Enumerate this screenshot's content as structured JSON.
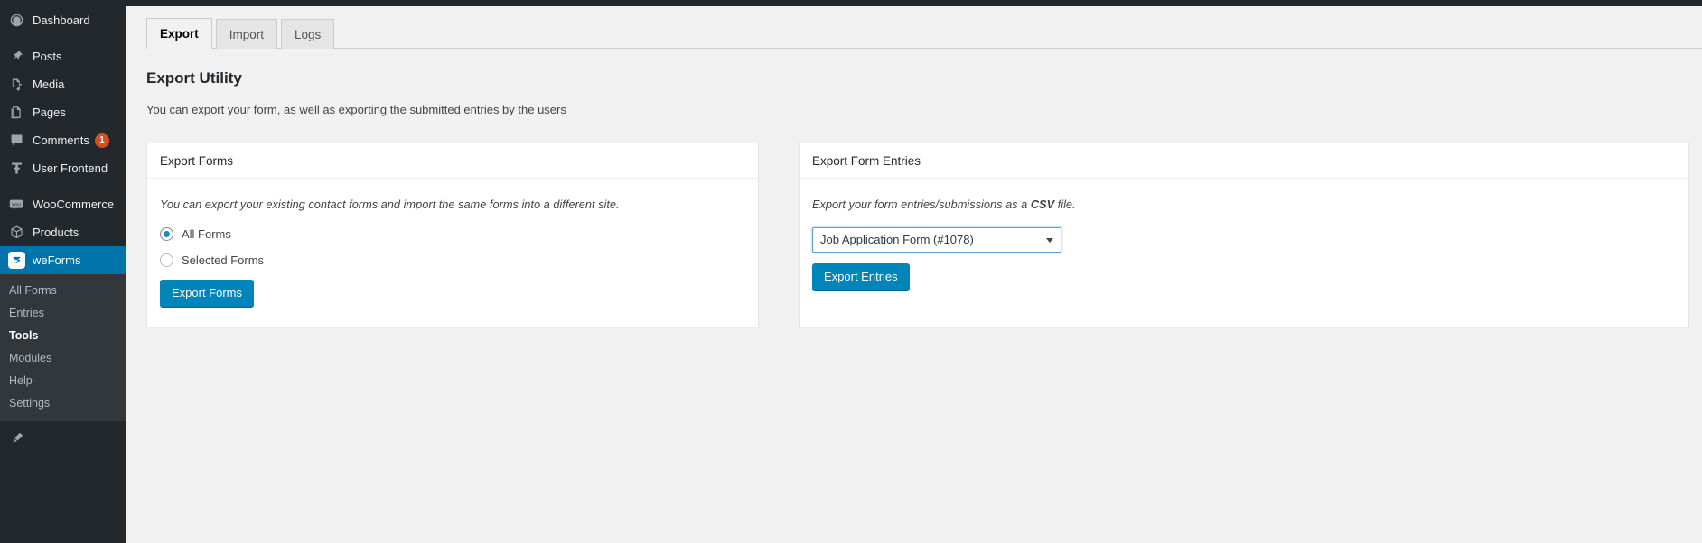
{
  "admin_menu": {
    "items": [
      {
        "label": "Dashboard",
        "icon": "dashboard-icon",
        "active": false
      },
      {
        "label": "Posts",
        "icon": "pin-icon",
        "active": false
      },
      {
        "label": "Media",
        "icon": "media-icon",
        "active": false
      },
      {
        "label": "Pages",
        "icon": "pages-icon",
        "active": false
      },
      {
        "label": "Comments",
        "icon": "comment-icon",
        "active": false,
        "badge": "1"
      },
      {
        "label": "User Frontend",
        "icon": "user-frontend-icon",
        "active": false
      },
      {
        "label": "WooCommerce",
        "icon": "woocommerce-icon",
        "active": false
      },
      {
        "label": "Products",
        "icon": "products-icon",
        "active": false
      },
      {
        "label": "weForms",
        "icon": "weforms-logo-icon",
        "active": true
      }
    ],
    "submenu": [
      {
        "label": "All Forms",
        "current": false
      },
      {
        "label": "Entries",
        "current": false
      },
      {
        "label": "Tools",
        "current": true
      },
      {
        "label": "Modules",
        "current": false
      },
      {
        "label": "Help",
        "current": false
      },
      {
        "label": "Settings",
        "current": false
      }
    ]
  },
  "tabs": [
    {
      "label": "Export",
      "active": true
    },
    {
      "label": "Import",
      "active": false
    },
    {
      "label": "Logs",
      "active": false
    }
  ],
  "page": {
    "title": "Export Utility",
    "description": "You can export your form, as well as exporting the submitted entries by the users"
  },
  "export_forms_card": {
    "heading": "Export Forms",
    "note": "You can export your existing contact forms and import the same forms into a different site.",
    "options": [
      {
        "label": "All Forms",
        "selected": true
      },
      {
        "label": "Selected Forms",
        "selected": false
      }
    ],
    "button_label": "Export Forms"
  },
  "export_entries_card": {
    "heading": "Export Form Entries",
    "note_prefix": "Export your form entries/submissions as a ",
    "note_strong": "CSV",
    "note_suffix": " file.",
    "selected_form": "Job Application Form (#1078)",
    "form_options": [
      "Job Application Form (#1078)"
    ],
    "button_label": "Export Entries"
  },
  "colors": {
    "admin_bg": "#23282d",
    "submenu_bg": "#32373c",
    "accent": "#0085ba",
    "active_menu": "#0073aa",
    "badge": "#d54e21",
    "content_bg": "#f1f1f1"
  }
}
